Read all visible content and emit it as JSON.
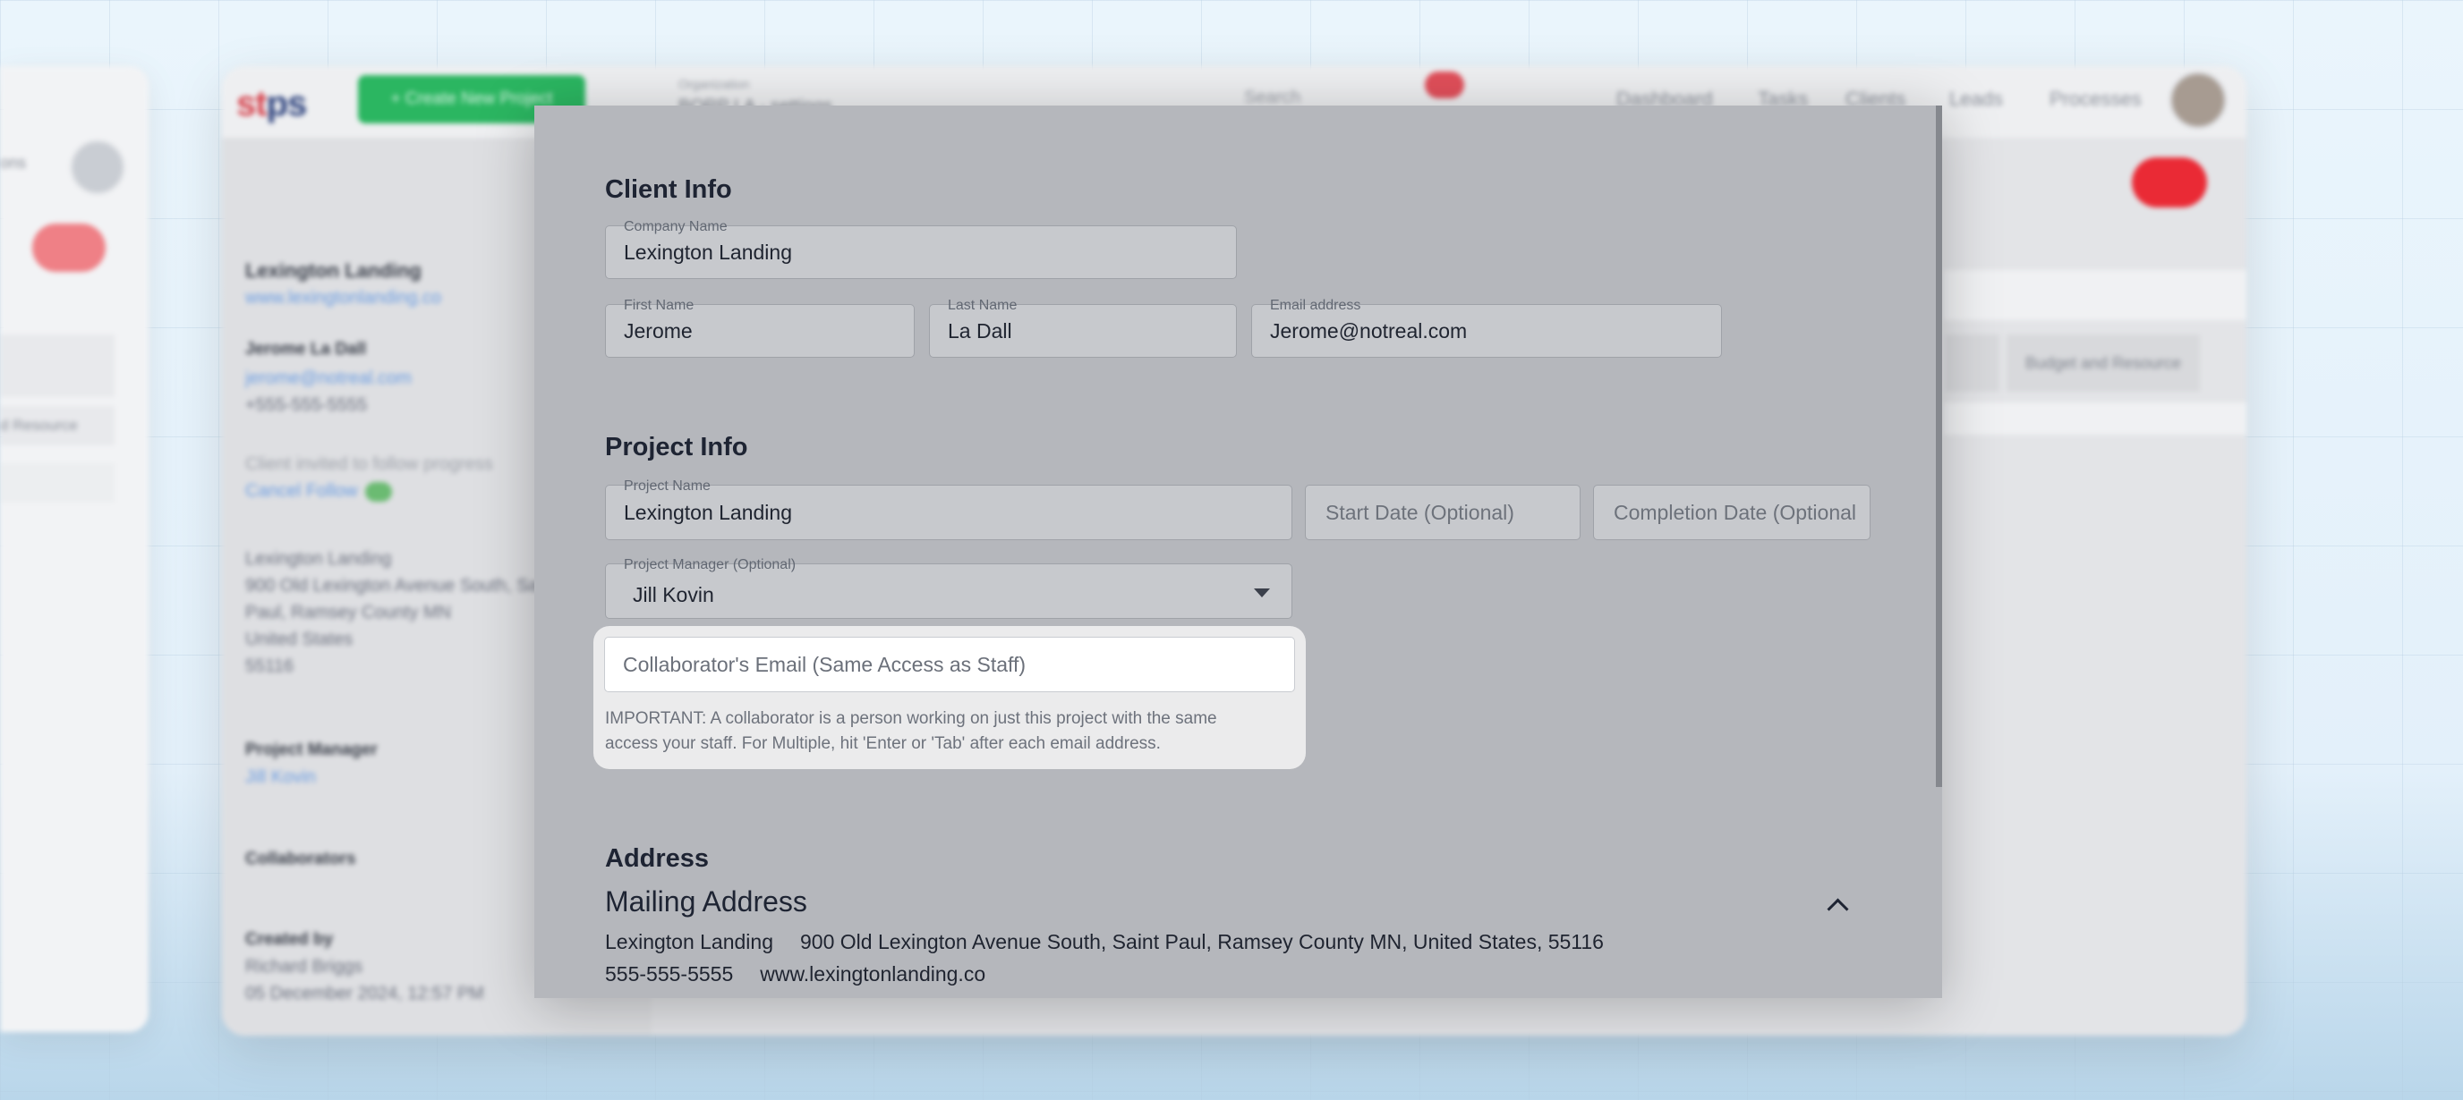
{
  "background": {
    "left_panel": {
      "text": "ons",
      "tab_text": "d Resource"
    },
    "app": {
      "logo_red": "st",
      "logo_blue": "ps",
      "create_button": "+ Create New Project",
      "org_label": "Organization",
      "org_value": "BORP LA - settings",
      "search_label": "Search",
      "nav": [
        "Dashboard",
        "Tasks",
        "Clients",
        "Leads",
        "Processes"
      ],
      "sidebar": {
        "company": "Lexington Landing",
        "website": "www.lexingtonlanding.co",
        "contact_name": "Jerome La Dall",
        "contact_email": "jerome@notreal.com",
        "contact_phone": "+555-555-5555",
        "followers_note": "Client invited to follow progress",
        "cancel_follow": "Cancel Follow",
        "addr_1": "Lexington Landing",
        "addr_2": "900 Old Lexington Avenue South, Sai",
        "addr_3": "Paul, Ramsey County MN",
        "addr_4": "United States",
        "addr_5": "55116",
        "pm_label": "Project Manager",
        "pm_value": "Jill Kovin",
        "collab_label": "Collaborators",
        "created_label": "Created by",
        "created_by": "Richard Briggs",
        "created_at": "05 December 2024, 12:57 PM"
      },
      "right_tab": "Budget and Resource"
    }
  },
  "modal": {
    "client_info": {
      "heading": "Client Info",
      "company_name": {
        "label": "Company Name",
        "value": "Lexington Landing"
      },
      "first_name": {
        "label": "First Name",
        "value": "Jerome"
      },
      "last_name": {
        "label": "Last Name",
        "value": "La Dall"
      },
      "email": {
        "label": "Email address",
        "value": "Jerome@notreal.com"
      }
    },
    "project_info": {
      "heading": "Project Info",
      "project_name": {
        "label": "Project Name",
        "value": "Lexington Landing"
      },
      "start_date": {
        "placeholder": "Start Date (Optional)"
      },
      "completion_date": {
        "placeholder": "Completion Date (Optional)"
      },
      "project_manager": {
        "label": "Project Manager (Optional)",
        "value": "Jill Kovin"
      },
      "collaborator": {
        "placeholder": "Collaborator's Email (Same Access as Staff)",
        "help": "IMPORTANT: A collaborator is a person working on just this project with the same access your staff. For Multiple, hit 'Enter or 'Tab' after each email address."
      }
    },
    "address": {
      "heading": "Address",
      "mailing_heading": "Mailing Address",
      "name": "Lexington Landing",
      "street": "900 Old Lexington Avenue South, Saint Paul, Ramsey County MN, United States, 55116",
      "phone": "555-555-5555",
      "website": "www.lexingtonlanding.co"
    }
  },
  "colors": {
    "modal_bg": "#b5b7bc",
    "field_bg": "#c7c9cd",
    "highlight_bg": "#ebebec",
    "brand_green": "#2bb661",
    "alert_red": "#ea2a35"
  }
}
